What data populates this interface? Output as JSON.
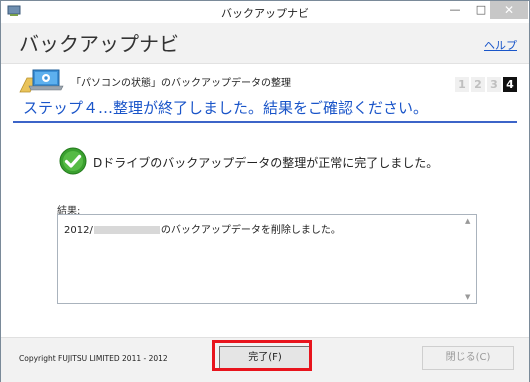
{
  "window": {
    "title": "バックアップナビ",
    "controls": {
      "minimize": "—",
      "maximize": "□",
      "close": "✕"
    }
  },
  "header": {
    "app_name": "バックアップナビ",
    "help_link": "ヘルプ"
  },
  "step": {
    "title": "「パソコンの状態」のバックアップデータの整理",
    "numbers": [
      "1",
      "2",
      "3",
      "4"
    ],
    "current": "4",
    "heading": "ステップ４…整理が終了しました。結果をご確認ください。"
  },
  "status": {
    "message": "Dドライブのバックアップデータの整理が正常に完了しました。",
    "icon": "check-circle-icon"
  },
  "result": {
    "label": "結果:",
    "text_prefix": "2012/",
    "text_suffix": "のバックアップデータを削除しました。"
  },
  "footer": {
    "copyright": "Copyright FUJITSU LIMITED 2011 - 2012",
    "finish_label": "完了(F)",
    "close_label": "閉じる(C)"
  },
  "colors": {
    "accent_blue": "#1a55c9",
    "highlight_red": "#e8141d",
    "check_green": "#3aa02f"
  }
}
